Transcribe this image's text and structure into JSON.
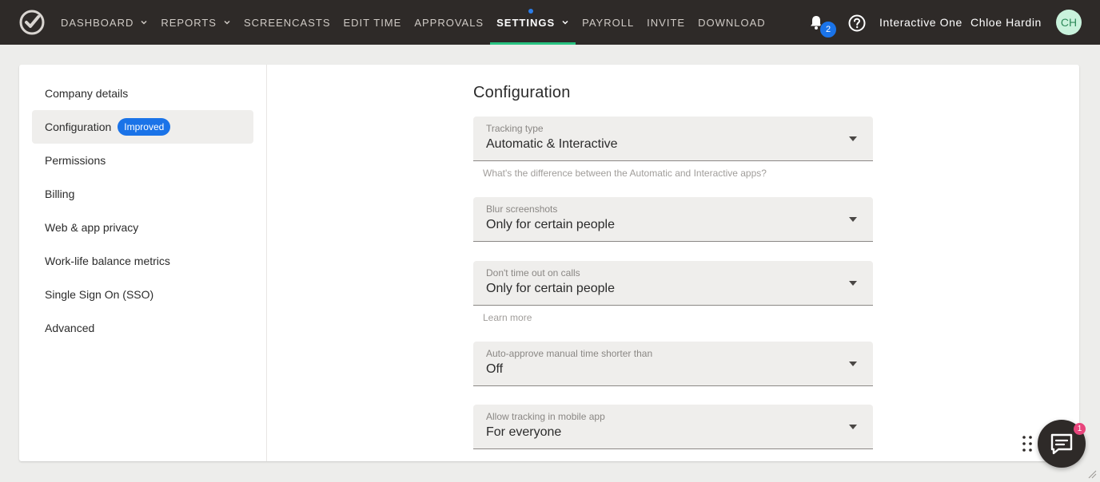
{
  "topbar": {
    "logo_icon": "app-logo-check-icon",
    "nav": [
      {
        "label": "DASHBOARD",
        "has_dropdown": true
      },
      {
        "label": "REPORTS",
        "has_dropdown": true
      },
      {
        "label": "SCREENCASTS",
        "has_dropdown": false
      },
      {
        "label": "EDIT TIME",
        "has_dropdown": false
      },
      {
        "label": "APPROVALS",
        "has_dropdown": false
      },
      {
        "label": "SETTINGS",
        "has_dropdown": true,
        "active": true
      },
      {
        "label": "PAYROLL",
        "has_dropdown": false
      },
      {
        "label": "INVITE",
        "has_dropdown": false
      },
      {
        "label": "DOWNLOAD",
        "has_dropdown": false
      }
    ],
    "notifications_count": "2",
    "notifications_icon": "bell-icon",
    "help_icon": "help-circle-icon",
    "company": "Interactive One",
    "user_name": "Chloe Hardin",
    "avatar_initials": "CH",
    "accent_color": "#28c281"
  },
  "sidebar": {
    "items": [
      {
        "label": "Company details"
      },
      {
        "label": "Configuration",
        "badge": "Improved",
        "active": true
      },
      {
        "label": "Permissions"
      },
      {
        "label": "Billing"
      },
      {
        "label": "Web & app privacy"
      },
      {
        "label": "Work-life balance metrics"
      },
      {
        "label": "Single Sign On (SSO)"
      },
      {
        "label": "Advanced"
      }
    ]
  },
  "main": {
    "title": "Configuration",
    "fields": [
      {
        "label": "Tracking type",
        "value": "Automatic & Interactive",
        "helper": "What's the difference between the Automatic and Interactive apps?"
      },
      {
        "label": "Blur screenshots",
        "value": "Only for certain people"
      },
      {
        "label": "Don't time out on calls",
        "value": "Only for certain people",
        "helper": "Learn more"
      },
      {
        "label": "Auto-approve manual time shorter than",
        "value": "Off"
      },
      {
        "label": "Allow tracking in mobile app",
        "value": "For everyone"
      }
    ]
  },
  "chat_widget": {
    "unread_count": "1",
    "icon": "chat-bubble-icon",
    "drag_icon": "drag-dots-icon"
  }
}
